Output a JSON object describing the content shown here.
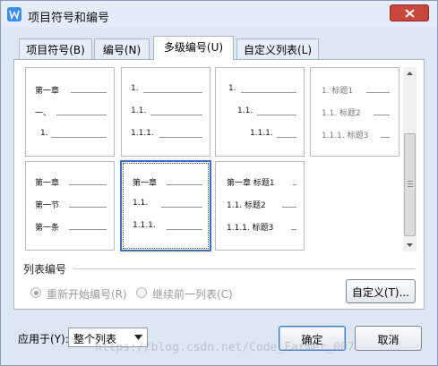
{
  "window": {
    "title": "项目符号和编号",
    "accent": "#3b8ded"
  },
  "tabs": [
    {
      "label": "项目符号(B)",
      "active": false
    },
    {
      "label": "编号(N)",
      "active": false
    },
    {
      "label": "多级编号(U)",
      "active": true
    },
    {
      "label": "自定义列表(L)",
      "active": false
    }
  ],
  "gallery": {
    "thumbnails": [
      {
        "lines": [
          "第一章",
          "一、",
          "1."
        ]
      },
      {
        "lines": [
          "1.",
          "1.1.",
          "1.1.1."
        ]
      },
      {
        "lines": [
          "1.",
          "1.1.",
          "1.1.1."
        ]
      },
      {
        "lines": [
          "1. 标题1",
          "1.1. 标题2",
          "1.1.1. 标题3"
        ]
      },
      {
        "lines": [
          "第一章",
          "第一节",
          "第一条"
        ]
      },
      {
        "lines": [
          "第一章",
          "1.1.",
          "1.1.1."
        ],
        "selected": true
      },
      {
        "lines": [
          "第一章 标题1",
          "1.1. 标题2",
          "1.1.1. 标题3"
        ]
      }
    ]
  },
  "list_numbering": {
    "section_label": "列表编号",
    "restart_label": "重新开始编号(R)",
    "continue_label": "继续前一列表(C)",
    "restart_checked": true,
    "define_label": "自定义(T)..."
  },
  "apply": {
    "label": "应用于(Y):",
    "value": "整个列表"
  },
  "buttons": {
    "ok": "确定",
    "cancel": "取消"
  },
  "watermark": "https://blog.csdn.net/Code_Farmer_007"
}
